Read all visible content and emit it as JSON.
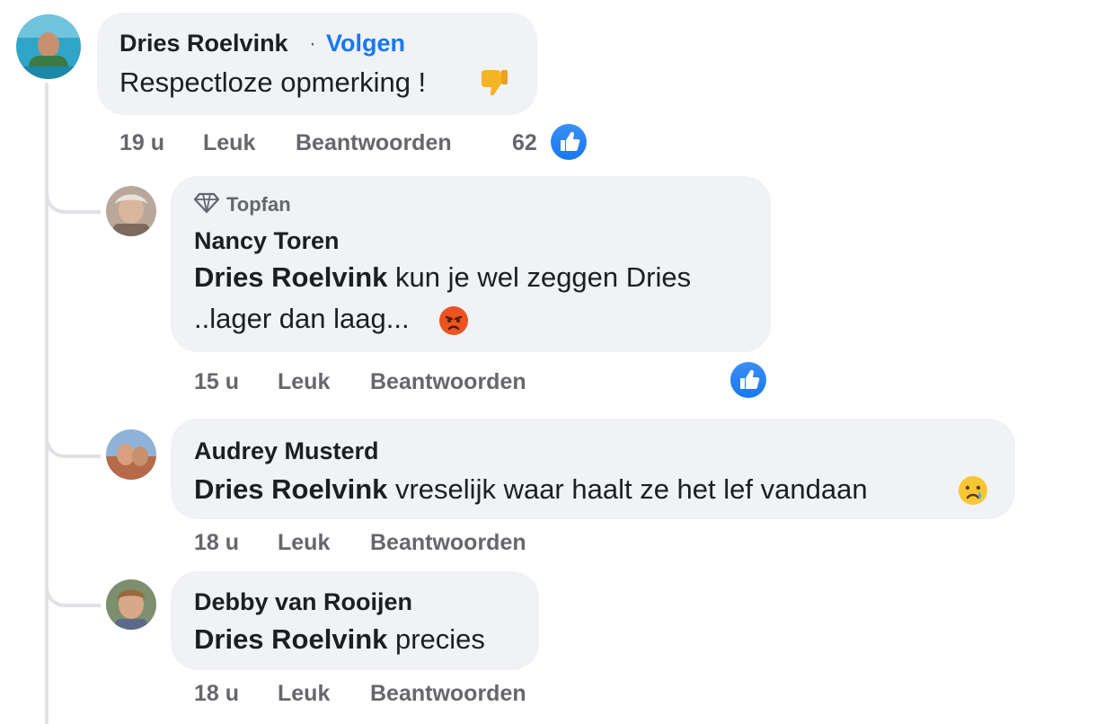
{
  "comments": [
    {
      "author": "Dries Roelvink",
      "separator": "·",
      "follow": "Volgen",
      "text": "Respectloze opmerking !",
      "time": "19 u",
      "like": "Leuk",
      "reply": "Beantwoorden",
      "reaction_count": "62"
    },
    {
      "badge": "Topfan",
      "author": "Nancy Toren",
      "mention": "Dries Roelvink",
      "text_line1": " kun je wel zeggen Dries",
      "text_line2": "..lager dan laag...",
      "time": "15 u",
      "like": "Leuk",
      "reply": "Beantwoorden"
    },
    {
      "author": "Audrey Musterd",
      "mention": "Dries Roelvink",
      "text": " vreselijk waar haalt ze het lef vandaan",
      "time": "18 u",
      "like": "Leuk",
      "reply": "Beantwoorden"
    },
    {
      "author": "Debby van Rooijen",
      "mention": "Dries Roelvink",
      "text": " precies",
      "time": "18 u",
      "like": "Leuk",
      "reply": "Beantwoorden"
    }
  ],
  "colors": {
    "accent": "#1877f2",
    "bubble": "#f0f2f5",
    "meta": "#65676b"
  }
}
